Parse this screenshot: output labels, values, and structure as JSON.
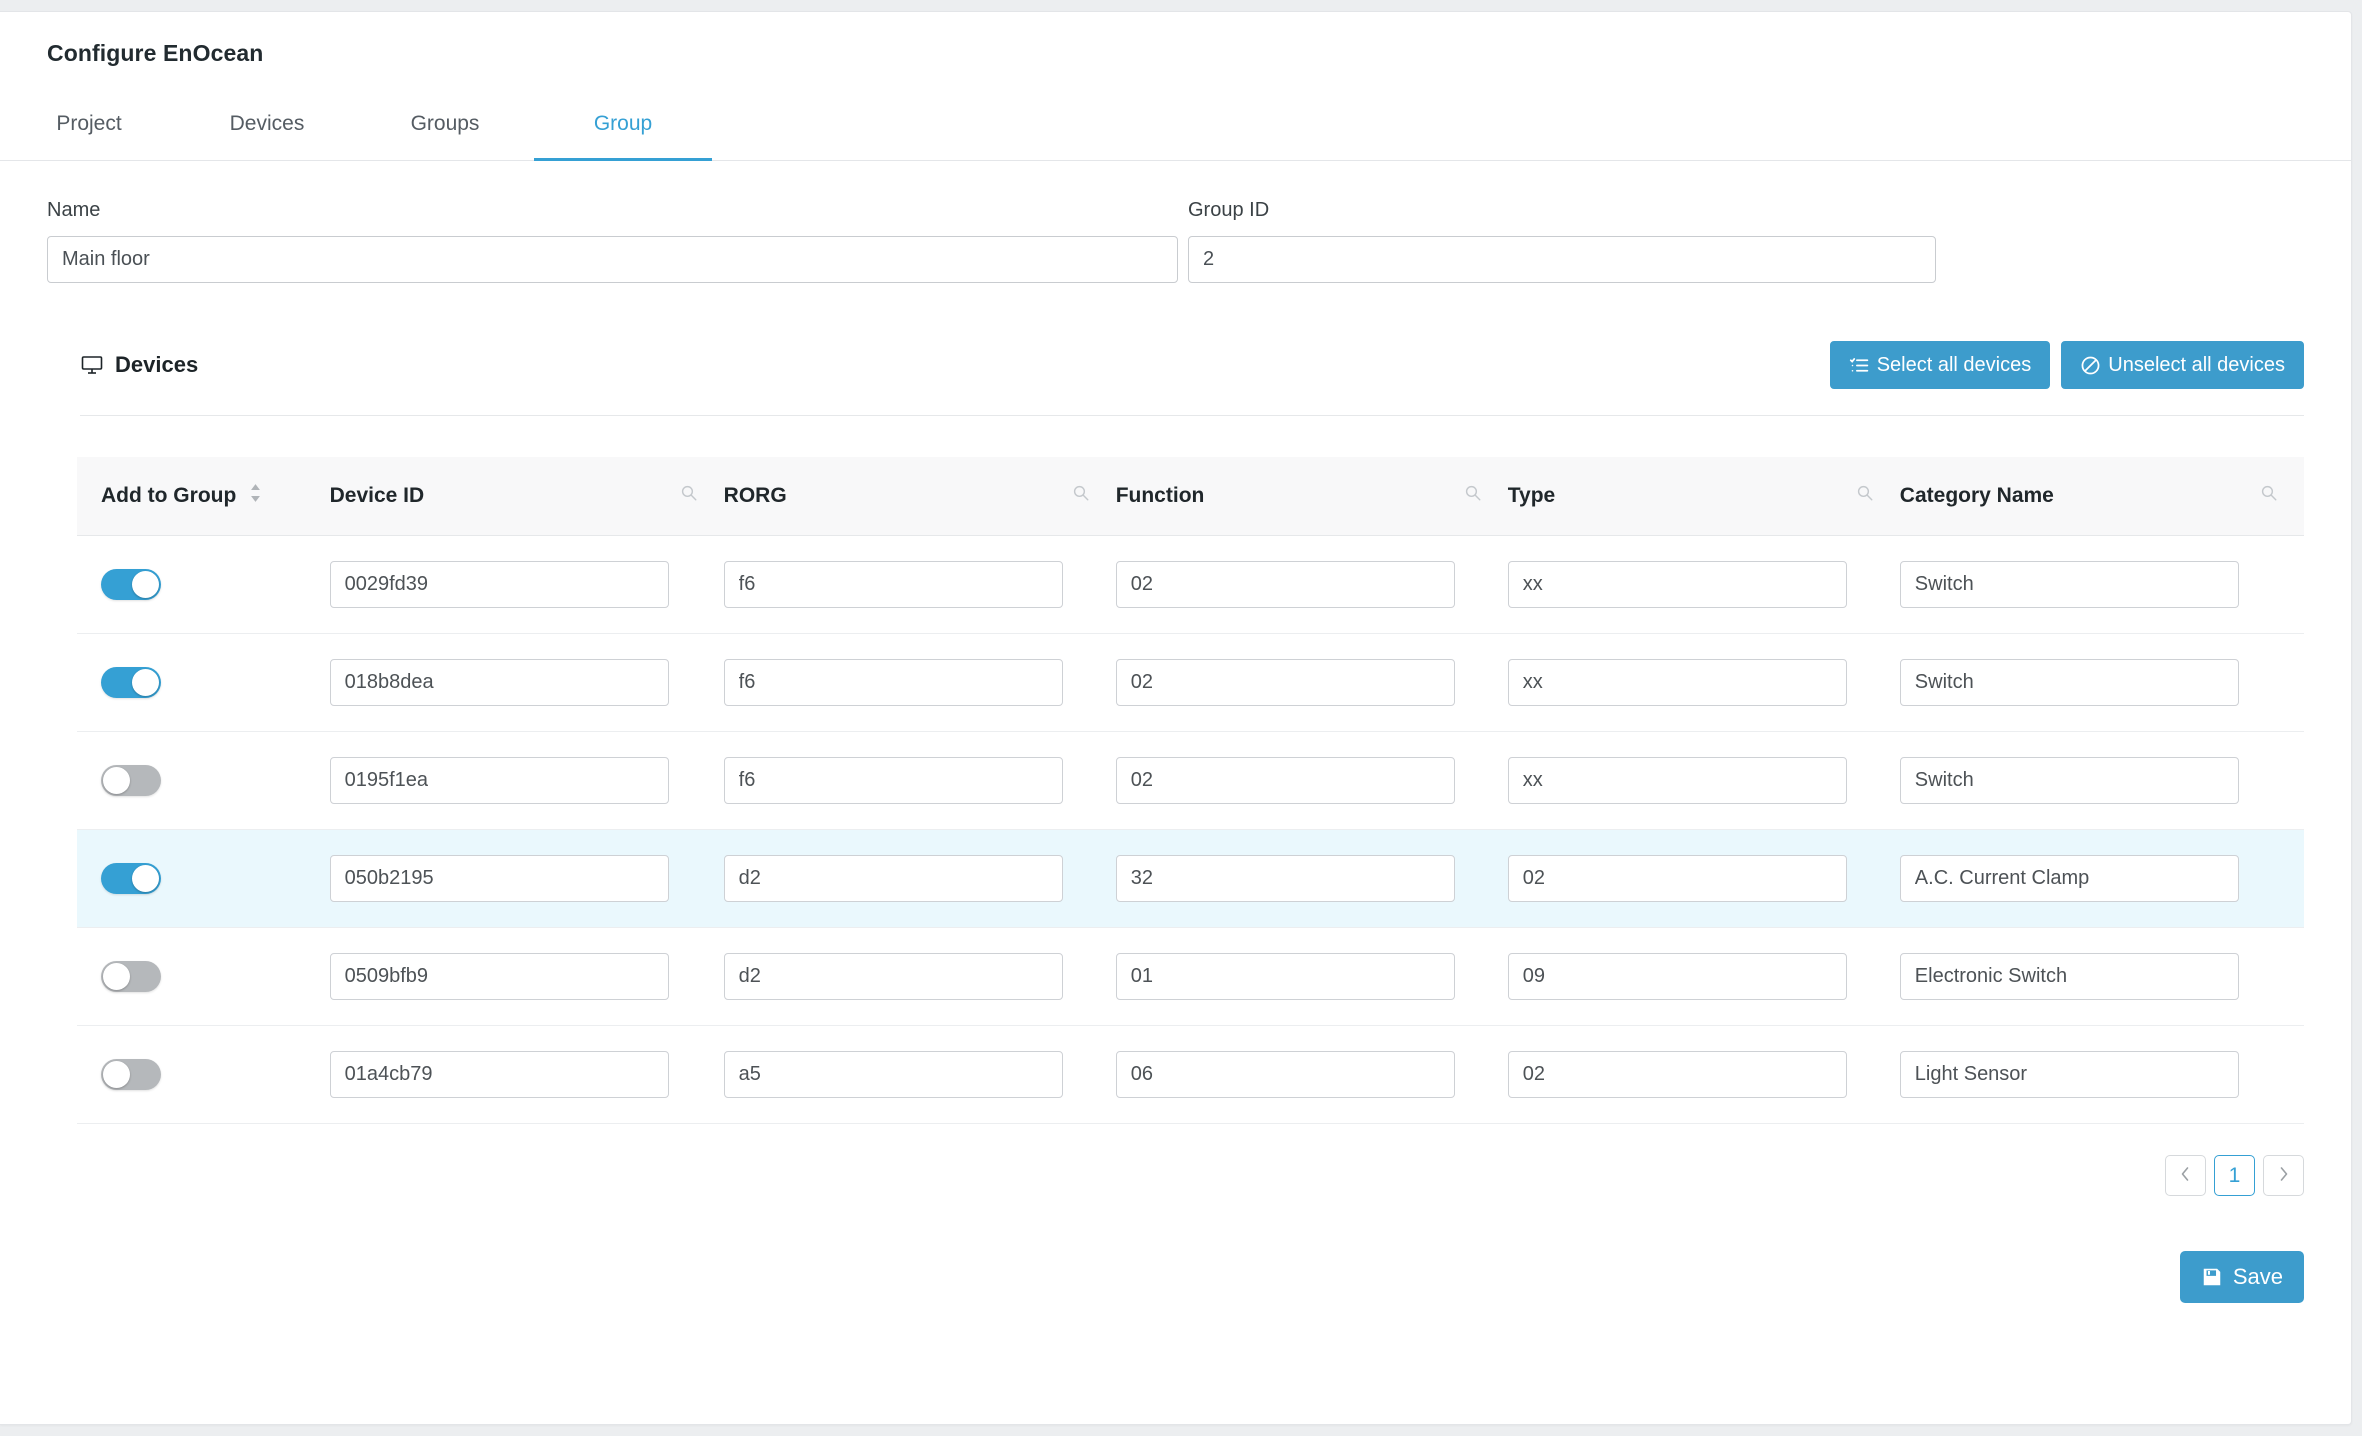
{
  "app": {
    "title": "Configure EnOcean"
  },
  "tabs": [
    {
      "label": "Project",
      "active": false
    },
    {
      "label": "Devices",
      "active": false
    },
    {
      "label": "Groups",
      "active": false
    },
    {
      "label": "Group",
      "active": true
    }
  ],
  "form": {
    "name_label": "Name",
    "name_value": "Main floor",
    "group_id_label": "Group ID",
    "group_id_value": "2"
  },
  "devices": {
    "section_title": "Devices",
    "section_icon": "monitor-icon",
    "select_all_label": "Select all devices",
    "select_all_icon": "task-list-icon",
    "unselect_all_label": "Unselect all devices",
    "unselect_all_icon": "ban-icon"
  },
  "table": {
    "columns": [
      {
        "label": "Add to Group",
        "icon": "sort-icon",
        "key": "add"
      },
      {
        "label": "Device ID",
        "icon": "search-icon",
        "key": "device_id"
      },
      {
        "label": "RORG",
        "icon": "search-icon",
        "key": "rorg"
      },
      {
        "label": "Function",
        "icon": "search-icon",
        "key": "function"
      },
      {
        "label": "Type",
        "icon": "search-icon",
        "key": "type"
      },
      {
        "label": "Category Name",
        "icon": "search-icon",
        "key": "category"
      }
    ],
    "rows": [
      {
        "add": true,
        "device_id": "0029fd39",
        "rorg": "f6",
        "function": "02",
        "type": "xx",
        "category": "Switch",
        "highlight": false
      },
      {
        "add": true,
        "device_id": "018b8dea",
        "rorg": "f6",
        "function": "02",
        "type": "xx",
        "category": "Switch",
        "highlight": false
      },
      {
        "add": false,
        "device_id": "0195f1ea",
        "rorg": "f6",
        "function": "02",
        "type": "xx",
        "category": "Switch",
        "highlight": false
      },
      {
        "add": true,
        "device_id": "050b2195",
        "rorg": "d2",
        "function": "32",
        "type": "02",
        "category": "A.C. Current Clamp",
        "highlight": true
      },
      {
        "add": false,
        "device_id": "0509bfb9",
        "rorg": "d2",
        "function": "01",
        "type": "09",
        "category": "Electronic Switch",
        "highlight": false
      },
      {
        "add": false,
        "device_id": "01a4cb79",
        "rorg": "a5",
        "function": "06",
        "type": "02",
        "category": "Light Sensor",
        "highlight": false
      }
    ]
  },
  "pagination": {
    "prev_icon": "chevron-left-icon",
    "next_icon": "chevron-right-icon",
    "pages": [
      "1"
    ],
    "current_page": "1"
  },
  "footer": {
    "save_label": "Save",
    "save_icon": "floppy-disk-icon"
  },
  "colors": {
    "accent": "#35a0d4",
    "button": "#3d9ccc",
    "highlight_row": "#eaf8fd",
    "toggle_off": "#b5b8bb",
    "page_bg": "#eceef0"
  }
}
